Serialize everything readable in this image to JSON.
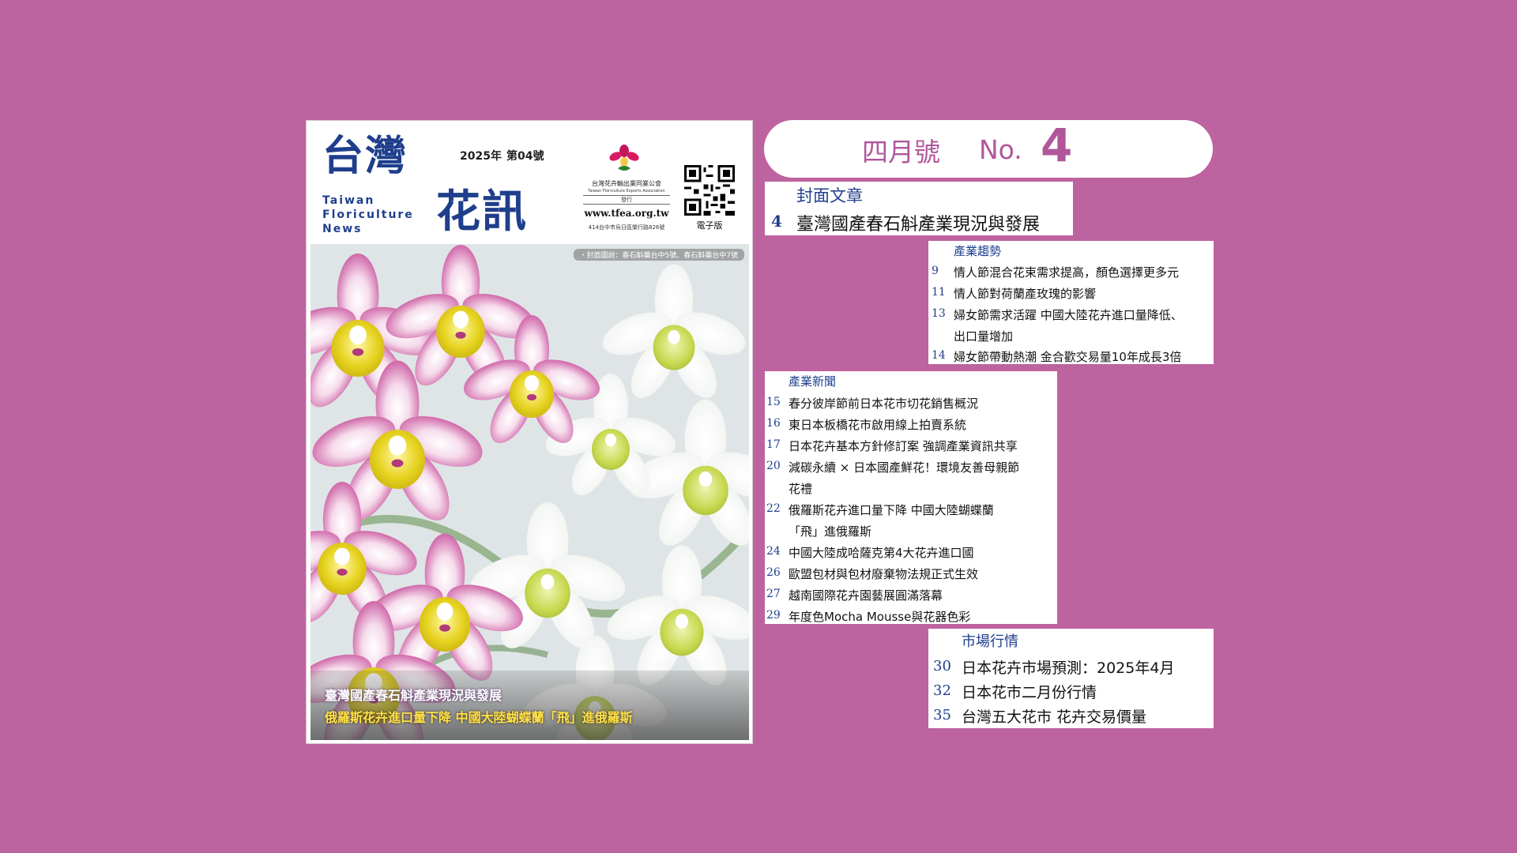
{
  "cover": {
    "title_zh_1": "台灣",
    "title_zh_2": "花訊",
    "title_en": [
      "Taiwan",
      "Floriculture",
      "News"
    ],
    "year": "2025年",
    "issue_no": "第04號",
    "org_name_zh": "台灣花卉輸出業同業公會",
    "org_name_en": "Taiwan Floriculture Exports Association",
    "issued_by": "發行",
    "org_url": "www.tfea.org.tw",
    "org_address": "414台中市烏日區榮行路826號",
    "qr_label": "電子版",
    "photo_caption": "・封面圖說：春石斛藥台中5號、春石斛藥台中7號",
    "headline_1": "臺灣國產春石斛產業現況與發展",
    "headline_2": "俄羅斯花卉進口量下降 中國大陸蝴蝶蘭「飛」進俄羅斯"
  },
  "issue_banner": {
    "month": "四月號",
    "no_label": "No.",
    "no_value": "4"
  },
  "sections": {
    "cover_story": {
      "title": "封面文章",
      "items": [
        {
          "page": "4",
          "text": "臺灣國產春石斛產業現況與發展"
        }
      ]
    },
    "industry_trends": {
      "title": "產業趨勢",
      "items": [
        {
          "page": "9",
          "lines": [
            "情人節混合花束需求提高，顏色選擇更多元"
          ]
        },
        {
          "page": "11",
          "lines": [
            "情人節對荷蘭產玫瑰的影響"
          ]
        },
        {
          "page": "13",
          "lines": [
            "婦女節需求活躍 中國大陸花卉進口量降低、",
            "出口量增加"
          ]
        },
        {
          "page": "14",
          "lines": [
            "婦女節帶動熱潮 金合歡交易量10年成長3倍"
          ]
        }
      ]
    },
    "industry_news": {
      "title": "產業新聞",
      "items": [
        {
          "page": "15",
          "lines": [
            "春分彼岸節前日本花市切花銷售概況"
          ]
        },
        {
          "page": "16",
          "lines": [
            "東日本板橋花市啟用線上拍賣系統"
          ]
        },
        {
          "page": "17",
          "lines": [
            "日本花卉基本方針修訂案 強調產業資訊共享"
          ]
        },
        {
          "page": "20",
          "lines": [
            "減碳永續 × 日本國產鮮花！環境友善母親節",
            "花禮"
          ]
        },
        {
          "page": "22",
          "lines": [
            "俄羅斯花卉進口量下降 中國大陸蝴蝶蘭",
            "「飛」進俄羅斯"
          ]
        },
        {
          "page": "24",
          "lines": [
            "中國大陸成哈薩克第4大花卉進口國"
          ]
        },
        {
          "page": "26",
          "lines": [
            "歐盟包材與包材廢棄物法規正式生效"
          ]
        },
        {
          "page": "27",
          "lines": [
            "越南國際花卉園藝展圓滿落幕"
          ]
        },
        {
          "page": "29",
          "lines": [
            "年度色Mocha Mousse與花器色彩"
          ]
        }
      ]
    },
    "market_info": {
      "title": "市場行情",
      "items": [
        {
          "page": "30",
          "text": "日本花卉市場預測：2025年4月"
        },
        {
          "page": "32",
          "text": "日本花市二月份行情"
        },
        {
          "page": "35",
          "text": "台灣五大花市 花卉交易價量"
        }
      ]
    }
  },
  "colors": {
    "background": "#bd63a0",
    "accent": "#b0579a",
    "navy": "#1f3e8c"
  }
}
